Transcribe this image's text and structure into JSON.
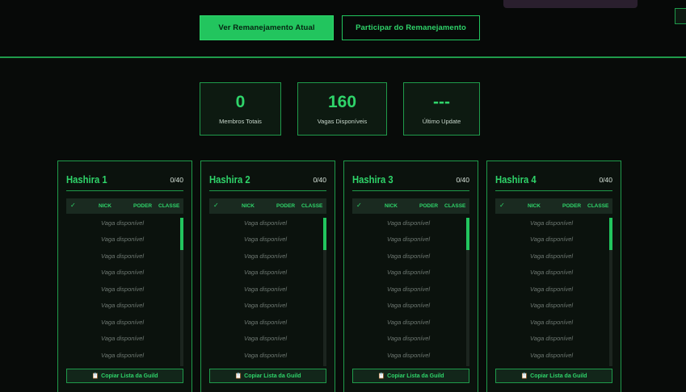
{
  "header": {
    "primary_button": "Ver Remanejamento Atual",
    "outline_button": "Participar do Remanejamento"
  },
  "stats": [
    {
      "value": "0",
      "label": "Membros Totais"
    },
    {
      "value": "160",
      "label": "Vagas Disponíveis"
    },
    {
      "value": "---",
      "label": "Último Update"
    }
  ],
  "table_headers": {
    "check": "✓",
    "nick": "NICK",
    "poder": "PODER",
    "classe": "CLASSE"
  },
  "slot_text": "Vaga disponível",
  "copy_label": "Copiar Lista da Guild",
  "copy_icon": "clipboard-icon",
  "accent_color": "#22c55e",
  "cards": [
    {
      "title": "Hashira 1",
      "count": "0/40"
    },
    {
      "title": "Hashira 2",
      "count": "0/40"
    },
    {
      "title": "Hashira 3",
      "count": "0/40"
    },
    {
      "title": "Hashira 4",
      "count": "0/40"
    }
  ]
}
